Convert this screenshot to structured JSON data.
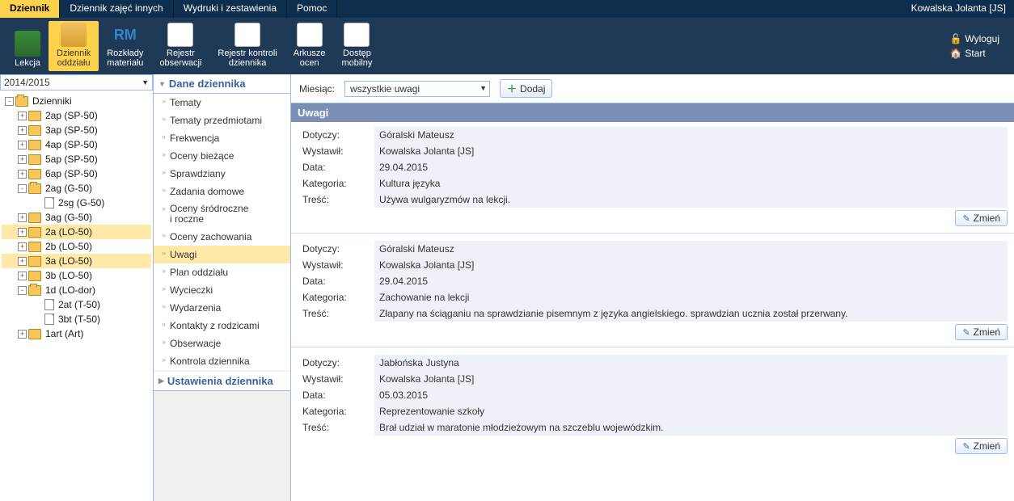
{
  "topTabs": [
    "Dziennik",
    "Dziennik zajęć innych",
    "Wydruki i zestawienia",
    "Pomoc"
  ],
  "topTabActive": 0,
  "user": "Kowalska Jolanta [JS]",
  "userLinks": {
    "logout": "Wyloguj",
    "start": "Start"
  },
  "ribbon": [
    {
      "label": "Lekcja",
      "id": "lekcja"
    },
    {
      "label": "Dziennik\noddziału",
      "id": "dziennik-oddzialu",
      "active": true
    },
    {
      "label": "Rozkłady\nmateriału",
      "id": "rozklady"
    },
    {
      "label": "Rejestr\nobserwacji",
      "id": "rejestr-obserwacji"
    },
    {
      "label": "Rejestr kontroli\ndziennika",
      "id": "rejestr-kontroli"
    },
    {
      "label": "Arkusze\nocen",
      "id": "arkusze-ocen"
    },
    {
      "label": "Dostęp\nmobilny",
      "id": "dostep-mobilny"
    }
  ],
  "year": "2014/2015",
  "tree": [
    {
      "label": "Dzienniki",
      "depth": 0,
      "icon": "folder-open",
      "exp": "-"
    },
    {
      "label": "2ap (SP-50)",
      "depth": 1,
      "icon": "folder",
      "exp": "+"
    },
    {
      "label": "3ap (SP-50)",
      "depth": 1,
      "icon": "folder",
      "exp": "+"
    },
    {
      "label": "4ap (SP-50)",
      "depth": 1,
      "icon": "folder",
      "exp": "+"
    },
    {
      "label": "5ap (SP-50)",
      "depth": 1,
      "icon": "folder",
      "exp": "+"
    },
    {
      "label": "6ap (SP-50)",
      "depth": 1,
      "icon": "folder",
      "exp": "+"
    },
    {
      "label": "2ag (G-50)",
      "depth": 1,
      "icon": "folder-open",
      "exp": "-"
    },
    {
      "label": "2sg (G-50)",
      "depth": 2,
      "icon": "file",
      "exp": ""
    },
    {
      "label": "3ag (G-50)",
      "depth": 1,
      "icon": "folder",
      "exp": "+"
    },
    {
      "label": "2a (LO-50)",
      "depth": 1,
      "icon": "folder",
      "exp": "+",
      "sel": true
    },
    {
      "label": "2b (LO-50)",
      "depth": 1,
      "icon": "folder",
      "exp": "+"
    },
    {
      "label": "3a (LO-50)",
      "depth": 1,
      "icon": "folder",
      "exp": "+",
      "sel": true
    },
    {
      "label": "3b (LO-50)",
      "depth": 1,
      "icon": "folder",
      "exp": "+"
    },
    {
      "label": "1d (LO-dor)",
      "depth": 1,
      "icon": "folder-open",
      "exp": "-"
    },
    {
      "label": "2at (T-50)",
      "depth": 2,
      "icon": "file",
      "exp": ""
    },
    {
      "label": "3bt (T-50)",
      "depth": 2,
      "icon": "file",
      "exp": ""
    },
    {
      "label": "1art (Art)",
      "depth": 1,
      "icon": "folder",
      "exp": "+"
    }
  ],
  "midHead1": "Dane dziennika",
  "midHead2": "Ustawienia dziennika",
  "midItems": [
    "Tematy",
    "Tematy przedmiotami",
    "Frekwencja",
    "Oceny bieżące",
    "Sprawdziany",
    "Zadania domowe",
    "Oceny śródroczne\ni roczne",
    "Oceny zachowania",
    "Uwagi",
    "Plan oddziału",
    "Wycieczki",
    "Wydarzenia",
    "Kontakty z rodzicami",
    "Obserwacje",
    "Kontrola dziennika"
  ],
  "midSelected": 8,
  "filter": {
    "monthLabel": "Miesiąc:",
    "monthValue": "wszystkie uwagi",
    "add": "Dodaj"
  },
  "sectionTitle": "Uwagi",
  "labels": {
    "dotyczy": "Dotyczy:",
    "wystawil": "Wystawił:",
    "data": "Data:",
    "kategoria": "Kategoria:",
    "tresc": "Treść:",
    "zmien": "Zmień"
  },
  "notes": [
    {
      "dotyczy": "Góralski Mateusz",
      "wystawil": "Kowalska Jolanta [JS]",
      "data": "29.04.2015",
      "kategoria": "Kultura języka",
      "tresc": "Używa wulgaryzmów na lekcji."
    },
    {
      "dotyczy": "Góralski Mateusz",
      "wystawil": "Kowalska Jolanta [JS]",
      "data": "29.04.2015",
      "kategoria": "Zachowanie na lekcji",
      "tresc": "Złapany na ściąganiu na sprawdzianie pisemnym z języka angielskiego. sprawdzian ucznia został przerwany."
    },
    {
      "dotyczy": "Jabłońska Justyna",
      "wystawil": "Kowalska Jolanta [JS]",
      "data": "05.03.2015",
      "kategoria": "Reprezentowanie szkoły",
      "tresc": "Brał udział w maratonie młodzieżowym na szczeblu wojewódzkim."
    }
  ]
}
